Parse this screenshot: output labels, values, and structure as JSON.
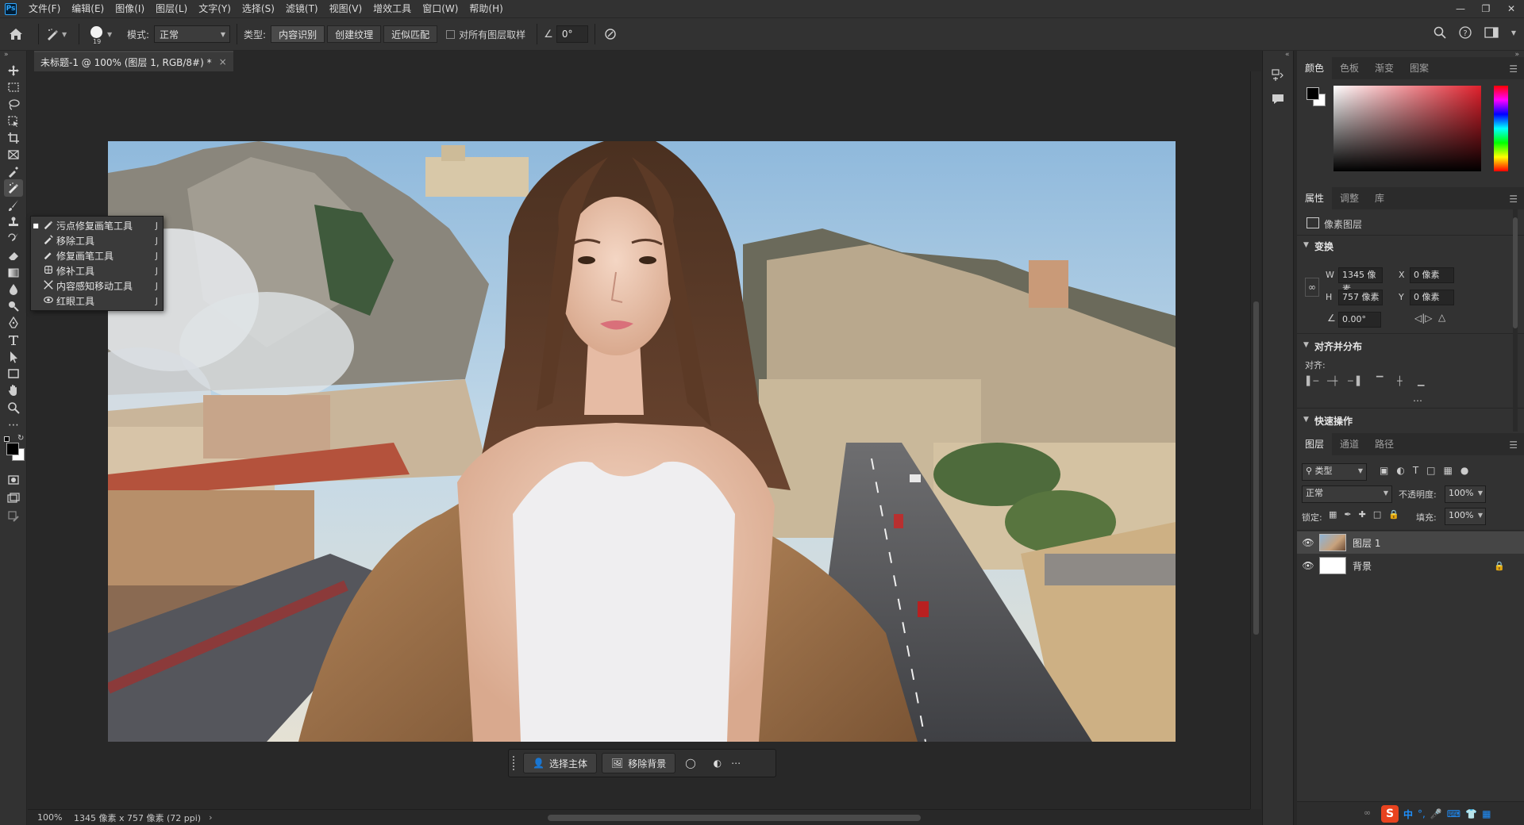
{
  "app": {
    "logo": "Ps",
    "menus": [
      "文件(F)",
      "编辑(E)",
      "图像(I)",
      "图层(L)",
      "文字(Y)",
      "选择(S)",
      "滤镜(T)",
      "视图(V)",
      "增效工具",
      "窗口(W)",
      "帮助(H)"
    ]
  },
  "options": {
    "brush_size": "19",
    "mode_label": "模式:",
    "mode_value": "正常",
    "type_label": "类型:",
    "type_buttons": [
      "内容识别",
      "创建纹理",
      "近似匹配"
    ],
    "sample_all_label": "对所有图层取样",
    "angle_value": "0°"
  },
  "document": {
    "tab_title": "未标题-1 @ 100% (图层 1, RGB/8#) *",
    "zoom": "100%",
    "info": "1345 像素 x 757 像素 (72 ppi)"
  },
  "flyout": {
    "items": [
      {
        "label": "污点修复画笔工具",
        "key": "J",
        "icon": "spot-healing-icon",
        "active": true
      },
      {
        "label": "移除工具",
        "key": "J",
        "icon": "remove-tool-icon"
      },
      {
        "label": "修复画笔工具",
        "key": "J",
        "icon": "healing-brush-icon"
      },
      {
        "label": "修补工具",
        "key": "J",
        "icon": "patch-tool-icon"
      },
      {
        "label": "内容感知移动工具",
        "key": "J",
        "icon": "content-aware-move-icon"
      },
      {
        "label": "红眼工具",
        "key": "J",
        "icon": "red-eye-icon"
      }
    ]
  },
  "taskbar": {
    "select_subject": "选择主体",
    "remove_bg": "移除背景"
  },
  "color_panel": {
    "tabs": [
      "颜色",
      "色板",
      "渐变",
      "图案"
    ],
    "foreground": "#000000",
    "background": "#ffffff"
  },
  "properties": {
    "tabs": [
      "属性",
      "调整",
      "库"
    ],
    "layer_type": "像素图层",
    "transform_title": "变换",
    "w_label": "W",
    "w_value": "1345 像素",
    "h_label": "H",
    "h_value": "757 像素",
    "x_label": "X",
    "x_value": "0 像素",
    "y_label": "Y",
    "y_value": "0 像素",
    "angle_value": "0.00°",
    "align_title": "对齐并分布",
    "align_label": "对齐:",
    "quick_actions_title": "快速操作"
  },
  "layers_panel": {
    "tabs": [
      "图层",
      "通道",
      "路径"
    ],
    "filter_value": "类型",
    "blend_mode": "正常",
    "opacity_label": "不透明度:",
    "opacity_value": "100%",
    "lock_label": "锁定:",
    "fill_label": "填充:",
    "fill_value": "100%",
    "layers": [
      {
        "name": "图层 1",
        "selected": true
      },
      {
        "name": "背景",
        "locked": true
      }
    ]
  },
  "ime": {
    "mode": "中"
  }
}
